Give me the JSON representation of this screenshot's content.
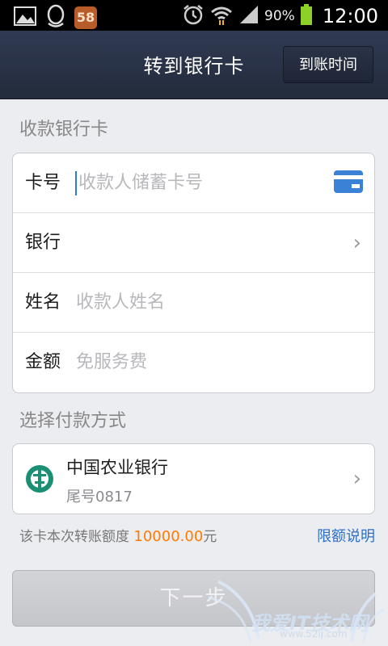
{
  "status_bar": {
    "notification_badge": "58",
    "battery_percent": "90%",
    "time": "12:00"
  },
  "header": {
    "title": "转到银行卡",
    "arrival_time_button": "到账时间"
  },
  "receiver_section": {
    "label": "收款银行卡",
    "fields": {
      "card_number": {
        "label": "卡号",
        "placeholder": "收款人储蓄卡号"
      },
      "bank": {
        "label": "银行"
      },
      "name": {
        "label": "姓名",
        "placeholder": "收款人姓名"
      },
      "amount": {
        "label": "金额",
        "placeholder": "免服务费"
      }
    }
  },
  "payment_section": {
    "label": "选择付款方式",
    "bank_name": "中国农业银行",
    "card_tail": "尾号0817"
  },
  "limit": {
    "text_prefix": "该卡本次转账额度",
    "amount": "10000.00",
    "unit": "元",
    "link": "限额说明"
  },
  "next_button": "下一步",
  "watermark": {
    "text": "我爱IT技术网",
    "url": "www.52ij.com"
  },
  "colors": {
    "header_bg": "#2a3247",
    "accent_blue": "#2c6fc9",
    "amount_orange": "#ff7a00",
    "card_icon_blue": "#3b82d6",
    "abc_green": "#1a8f74"
  },
  "icons": [
    "gallery-icon",
    "qq-icon",
    "alarm-icon",
    "wifi-icon",
    "signal-icon",
    "battery-icon",
    "bank-card-icon",
    "chevron-right-icon",
    "abc-bank-logo-icon"
  ]
}
